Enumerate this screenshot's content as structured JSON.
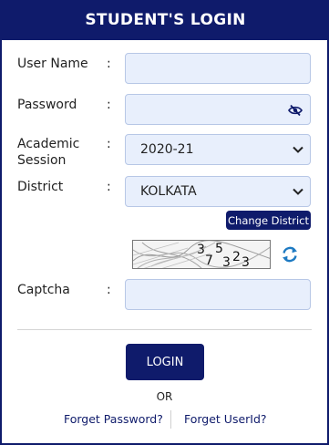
{
  "header": {
    "title": "STUDENT'S LOGIN"
  },
  "form": {
    "colon": ":",
    "username": {
      "label": "User Name",
      "value": "",
      "placeholder": ""
    },
    "password": {
      "label": "Password",
      "value": "",
      "placeholder": "",
      "toggle_icon": "eye-slash-icon"
    },
    "session": {
      "label_line1": "Academic",
      "label_line2": "Session",
      "selected": "2020-21"
    },
    "district": {
      "label": "District",
      "selected": "KOLKATA",
      "change_label": "Change District"
    },
    "captcha": {
      "label": "Captcha",
      "image_text": "35 7323",
      "value": "",
      "refresh_icon": "refresh-icon"
    }
  },
  "actions": {
    "login_label": "LOGIN",
    "or_label": "OR",
    "forget_password_label": "Forget Password?",
    "forget_userid_label": "Forget UserId?"
  },
  "colors": {
    "primary": "#0f1b6b",
    "input_bg": "#e8effc",
    "input_border": "#b7c7e6",
    "refresh_icon": "#1e7ac2"
  }
}
